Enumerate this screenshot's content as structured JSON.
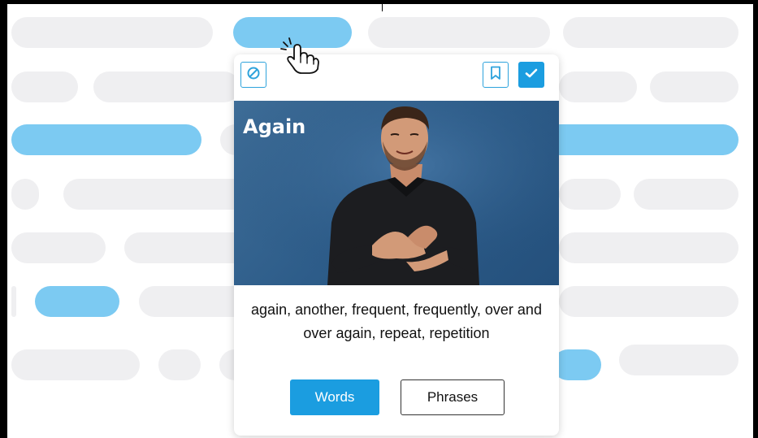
{
  "card": {
    "sign_word": "Again",
    "meaning": "again, another, frequent, frequently, over and over again, repeat, repetition",
    "tabs": {
      "words": "Words",
      "phrases": "Phrases"
    },
    "active_tab": "words",
    "icons": {
      "block": "block-icon",
      "bookmark": "bookmark-icon",
      "check": "check-icon"
    }
  },
  "colors": {
    "accent": "#1b9de0",
    "highlight_pill": "#7ccaf2",
    "placeholder_pill": "#efeff1",
    "video_background": "#2d5c89"
  }
}
